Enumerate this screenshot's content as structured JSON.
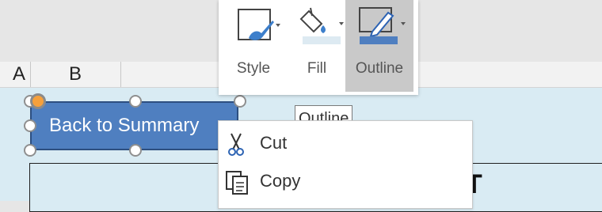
{
  "mini_toolbar": {
    "buttons": [
      {
        "label": "Style",
        "icon": "shape-style-icon"
      },
      {
        "label": "Fill",
        "icon": "fill-bucket-icon",
        "swatch_color": "#ddeaf2"
      },
      {
        "label": "Outline",
        "icon": "outline-pen-icon",
        "swatch_color": "#4f7fc0",
        "selected": true
      }
    ]
  },
  "tooltip": {
    "text": "Outline"
  },
  "sheet": {
    "columns": [
      "A",
      "B"
    ],
    "shape_text": "Back to Summary",
    "partial_text": "T"
  },
  "context_menu": {
    "items": [
      {
        "label": "Cut",
        "accelerator": "t",
        "icon": "scissors-icon"
      },
      {
        "label": "Copy",
        "accelerator": "C",
        "icon": "copy-icon"
      }
    ]
  },
  "colors": {
    "shape_fill": "#4f7fc0",
    "sheet_fill": "#d9ebf3",
    "rotate_handle": "#f5a03c"
  }
}
